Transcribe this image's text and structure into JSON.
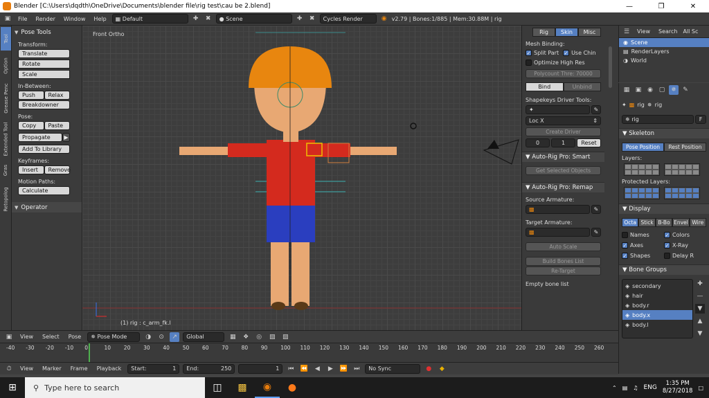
{
  "window": {
    "title": "Blender [C:\\Users\\dqdth\\OneDrive\\Documents\\blender file\\rig test\\cau be 2.blend]"
  },
  "infobar": {
    "menus": [
      "File",
      "Render",
      "Window",
      "Help"
    ],
    "layout": "Default",
    "scene": "Scene",
    "engine": "Cycles Render",
    "stats": "v2.79 | Bones:1/885 | Mem:30.88M | rig"
  },
  "left_tabs": [
    "Tool",
    "Option",
    "Grease Penc",
    "Extended Tool",
    "Gras",
    "Retopolog"
  ],
  "toolshelf": {
    "header": "Pose Tools",
    "transform_label": "Transform:",
    "transform": [
      "Translate",
      "Rotate",
      "Scale"
    ],
    "inbetween_label": "In-Between:",
    "push": "Push",
    "relax": "Relax",
    "breakdowner": "Breakdowner",
    "pose_label": "Pose:",
    "copy": "Copy",
    "paste": "Paste",
    "propagate": "Propagate",
    "add_to_library": "Add To Library",
    "keyframes_label": "Keyframes:",
    "insert": "Insert",
    "remove": "Remove",
    "motion_label": "Motion Paths:",
    "calculate": "Calculate",
    "operator": "Operator"
  },
  "viewport": {
    "label": "Front Ortho",
    "status": "(1) rig : c_arm_fk.l"
  },
  "npanel": {
    "tabs": [
      "Rig",
      "Skin",
      "Misc"
    ],
    "mesh_binding": "Mesh Binding:",
    "split_parts": "Split Part",
    "use_chin": "Use Chin",
    "optimize": "Optimize High Res",
    "polycount": "Polycount Thre: 70000",
    "bind": "Bind",
    "unbind": "Unbind",
    "shapekeys": "Shapekeys Driver Tools:",
    "loc": "Loc X",
    "create_driver": "Create Driver",
    "driver_val0": "0",
    "driver_val1": "1",
    "reset": "Reset",
    "smart": "Auto-Rig Pro: Smart",
    "get_selected": "Get Selected Objects",
    "remap": "Auto-Rig Pro: Remap",
    "source_armature": "Source Armature:",
    "target_armature": "Target Armature:",
    "auto_scale": "Auto Scale",
    "build_bones": "Build Bones List",
    "retarget": "Re-Target",
    "empty_bone": "Empty bone list"
  },
  "outliner": {
    "view": "View",
    "search": "Search",
    "all": "All Sc",
    "items": [
      "Scene",
      "RenderLayers",
      "World"
    ]
  },
  "properties": {
    "breadcrumb_obj": "rig",
    "breadcrumb_data": "rig",
    "name": "rig",
    "f": "F",
    "skeleton": "Skeleton",
    "pose_position": "Pose Position",
    "rest_position": "Rest Position",
    "layers": "Layers:",
    "protected": "Protected Layers:",
    "display": "Display",
    "display_types": [
      "Octa",
      "Stick",
      "B-Bo",
      "Envel",
      "Wire"
    ],
    "names": "Names",
    "colors": "Colors",
    "axes": "Axes",
    "xray": "X-Ray",
    "shapes": "Shapes",
    "delay": "Delay R",
    "bone_groups": "Bone Groups",
    "groups": [
      "secondary",
      "hair",
      "body.r",
      "body.x",
      "body.l"
    ]
  },
  "timeline": {
    "header_menus": [
      "View",
      "Select",
      "Pose"
    ],
    "mode": "Pose Mode",
    "orientation": "Global",
    "ticks": [
      "-40",
      "-30",
      "-20",
      "-10",
      "0",
      "10",
      "20",
      "30",
      "40",
      "50",
      "60",
      "70",
      "80",
      "90",
      "100",
      "110",
      "120",
      "130",
      "140",
      "150",
      "160",
      "170",
      "180",
      "190",
      "200",
      "210",
      "220",
      "230",
      "240",
      "250",
      "260"
    ],
    "ctrl_menus": [
      "View",
      "Marker",
      "Frame",
      "Playback"
    ],
    "start": "Start:",
    "start_val": "1",
    "end": "End:",
    "end_val": "250",
    "current": "1",
    "sync": "No Sync"
  },
  "taskbar": {
    "search": "Type here to search",
    "lang": "ENG",
    "time": "1:35 PM",
    "date": "8/27/2018"
  },
  "colors": {
    "accent": "#5680c2",
    "hat": "#e8860f",
    "shirt": "#d42a1e",
    "shorts": "#2a3ebf",
    "skin": "#e8a873"
  }
}
